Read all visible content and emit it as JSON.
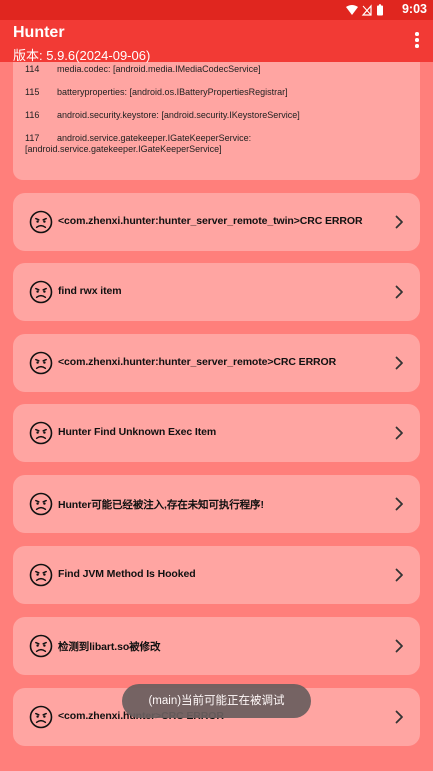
{
  "status": {
    "time": "9:03"
  },
  "appbar": {
    "title": "Hunter",
    "version": "版本: 5.9.6(2024-09-06)"
  },
  "services": [
    {
      "num": "114",
      "text": "media.codec: [android.media.IMediaCodecService]"
    },
    {
      "num": "115",
      "text": "batteryproperties: [android.os.IBatteryPropertiesRegistrar]"
    },
    {
      "num": "116",
      "text": "android.security.keystore: [android.security.IKeystoreService]"
    },
    {
      "num": "117",
      "text": "android.service.gatekeeper.IGateKeeperService:",
      "cont": "[android.service.gatekeeper.IGateKeeperService]"
    }
  ],
  "items": [
    {
      "label": "<com.zhenxi.hunter:hunter_server_remote_twin>CRC ERROR"
    },
    {
      "label": "find rwx item"
    },
    {
      "label": "<com.zhenxi.hunter:hunter_server_remote>CRC ERROR"
    },
    {
      "label": "Hunter Find Unknown Exec Item"
    },
    {
      "label": "Hunter可能已经被注入,存在未知可执行程序!"
    },
    {
      "label": "Find JVM Method Is Hooked"
    },
    {
      "label": "检测到libart.so被修改"
    },
    {
      "label": "<com.zhenxi.hunter>CRC ERROR"
    }
  ],
  "toast": {
    "text": "(main)当前可能正在被调试"
  },
  "icons": {
    "face": "sad-face-icon",
    "chevron": "chevron-right-icon",
    "menu": "more-vert-icon",
    "wifi": "wifi-icon",
    "signal": "no-signal-icon",
    "battery": "battery-icon"
  },
  "colors": {
    "background": "#ff7f7b",
    "card": "#ffa5a2",
    "appbar": "#f23a35",
    "statusbar": "#e0261f",
    "toast": "#6b5f5f"
  }
}
